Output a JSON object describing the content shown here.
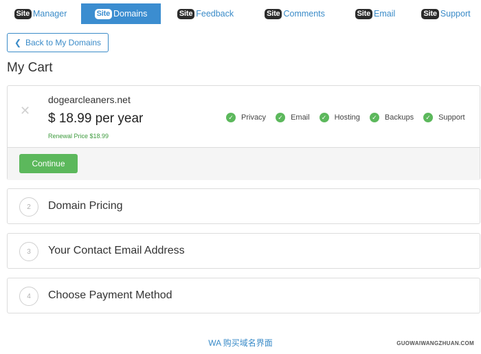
{
  "nav": {
    "badge_text": "Site",
    "tabs": [
      {
        "label": "Manager",
        "active": false
      },
      {
        "label": "Domains",
        "active": true
      },
      {
        "label": "Feedback",
        "active": false
      },
      {
        "label": "Comments",
        "active": false
      },
      {
        "label": "Email",
        "active": false
      },
      {
        "label": "Support",
        "active": false
      }
    ]
  },
  "back_button": {
    "label": "Back to My Domains"
  },
  "page_title": "My Cart",
  "cart_item": {
    "remove_symbol": "✕",
    "domain": "dogearcleaners.net",
    "price": "$ 18.99 per year",
    "renewal": "Renewal Price $18.99",
    "features": [
      "Privacy",
      "Email",
      "Hosting",
      "Backups",
      "Support"
    ],
    "continue_label": "Continue"
  },
  "steps": [
    {
      "number": "2",
      "label": "Domain Pricing"
    },
    {
      "number": "3",
      "label": "Your Contact Email Address"
    },
    {
      "number": "4",
      "label": "Choose Payment Method"
    }
  ],
  "caption": "WA 购买域名界面",
  "watermark": "GUOWAIWANGZHUAN.COM",
  "colors": {
    "accent": "#3b8dd0",
    "success": "#5cb85c"
  }
}
